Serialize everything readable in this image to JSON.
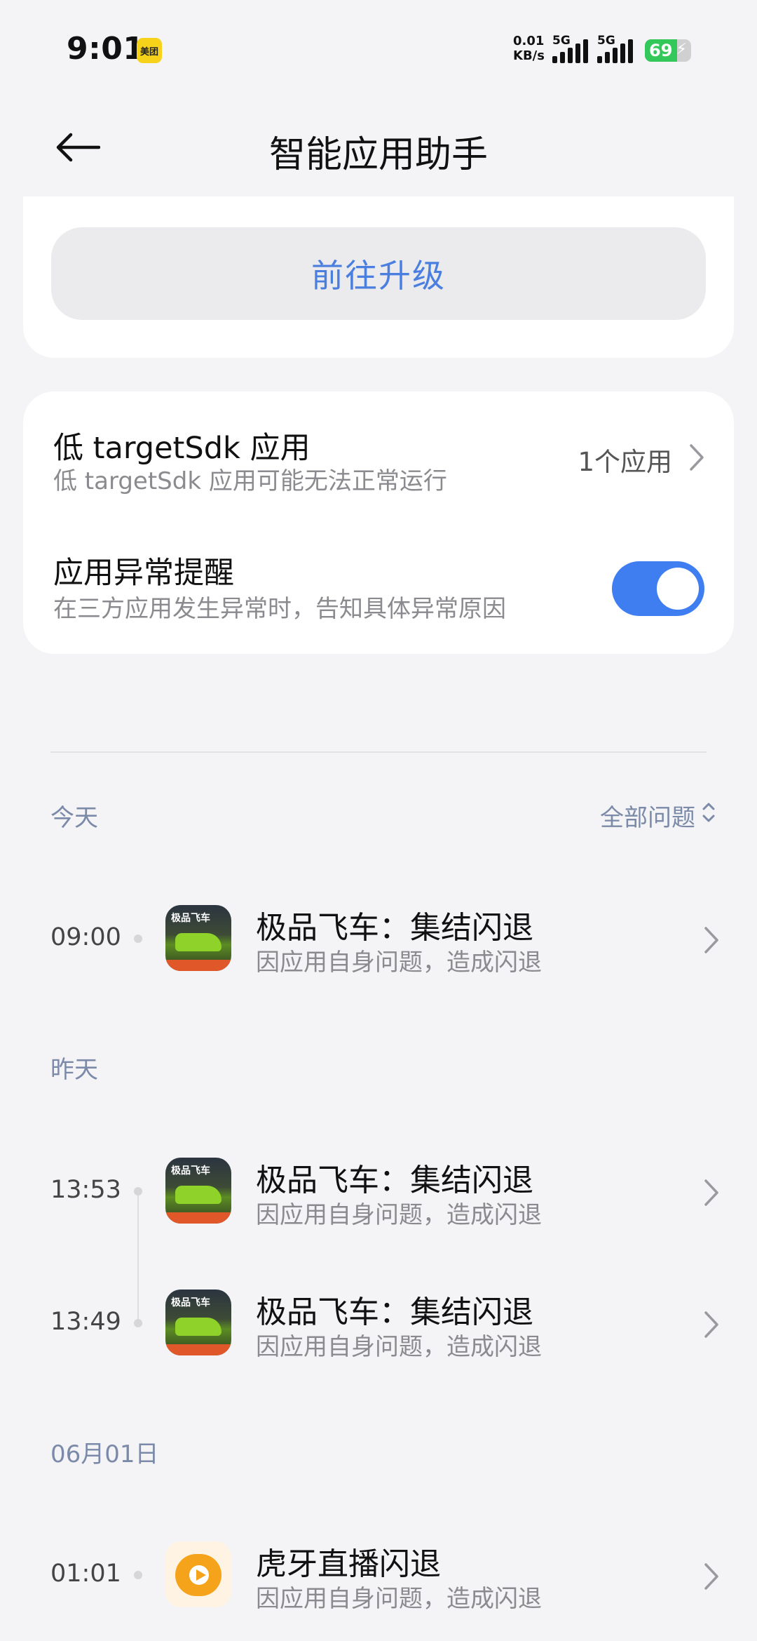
{
  "status_bar": {
    "time": "9:01",
    "notification_app": "美团",
    "net_speed_value": "0.01",
    "net_speed_unit": "KB/s",
    "signal1_label": "5G",
    "signal2_label": "5G",
    "battery_percent": "69",
    "battery_level": 0.69
  },
  "header": {
    "title": "智能应用助手"
  },
  "upgrade": {
    "button_label": "前往升级"
  },
  "settings": {
    "low_sdk": {
      "title": "低 targetSdk 应用",
      "subtitle": "低 targetSdk 应用可能无法正常运行",
      "value": "1个应用"
    },
    "alert": {
      "title": "应用异常提醒",
      "subtitle": "在三方应用发生异常时，告知具体异常原因",
      "enabled": true
    }
  },
  "history": {
    "filter_label": "全部问题",
    "sections": [
      {
        "label": "今天",
        "events": [
          {
            "time": "09:00",
            "name": "极品飞车：集结闪退",
            "desc": "因应用自身问题，造成闪退",
            "icon": "need-for-speed-app-icon"
          }
        ]
      },
      {
        "label": "昨天",
        "events": [
          {
            "time": "13:53",
            "name": "极品飞车：集结闪退",
            "desc": "因应用自身问题，造成闪退",
            "icon": "need-for-speed-app-icon"
          },
          {
            "time": "13:49",
            "name": "极品飞车：集结闪退",
            "desc": "因应用自身问题，造成闪退",
            "icon": "need-for-speed-app-icon"
          }
        ]
      },
      {
        "label": "06月01日",
        "events": [
          {
            "time": "01:01",
            "name": "虎牙直播闪退",
            "desc": "因应用自身问题，造成闪退",
            "icon": "huya-app-icon"
          }
        ]
      }
    ]
  },
  "colors": {
    "accent": "#3f7ef0",
    "link_text": "#4a7fe0",
    "section_label": "#7b8aa8",
    "background": "#f4f4f6"
  }
}
